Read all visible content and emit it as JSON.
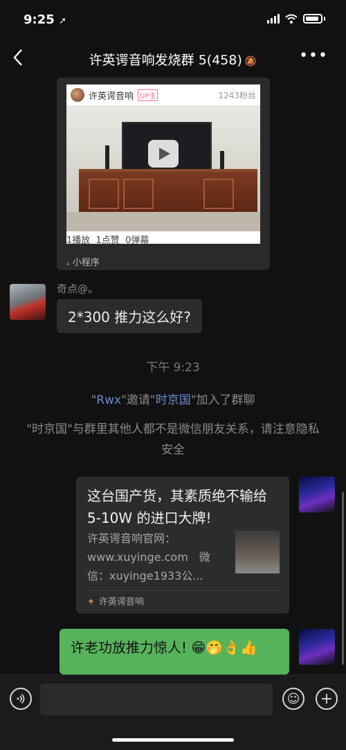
{
  "status_bar": {
    "time": "9:25",
    "location_glyph": "➚"
  },
  "nav": {
    "back_glyph": "‹",
    "title": "许英谔音响发烧群 5(458)",
    "mute_glyph": "🔕",
    "more_glyph": "•••"
  },
  "shared_card": {
    "uploader": "许英谔音响",
    "up_tag": "UP主",
    "fans": "1243粉丝",
    "stats": "1播放  1点赞  0弹幕",
    "mini_program_label": "小程序"
  },
  "messages": {
    "sender_1": "奇点@。",
    "msg_1": "2*300 推力这么好?",
    "timestamp": "下午 9:23",
    "system_1": {
      "q1": "\"",
      "inviter": "Rwx",
      "q2": "\"邀请\"",
      "invitee": "时京国",
      "q3": "\"加入了群聊"
    },
    "system_2": "\"时京国\"与群里其他人都不是微信朋友关系，请注意隐私安全",
    "link_card": {
      "title": "这台国产货，其素质绝不输给 5-10W 的进口大牌!",
      "desc": "许英谔音响官网：www.xuyinge.com　微信：xuyinge1933公...",
      "source": "许英谔音响"
    },
    "msg_2": "许老功放推力惊人! 😁🤭👌👍"
  },
  "input_bar": {
    "placeholder": "",
    "voice_glyph": "◉",
    "emoji_glyph": "☺",
    "plus_glyph": "+"
  }
}
